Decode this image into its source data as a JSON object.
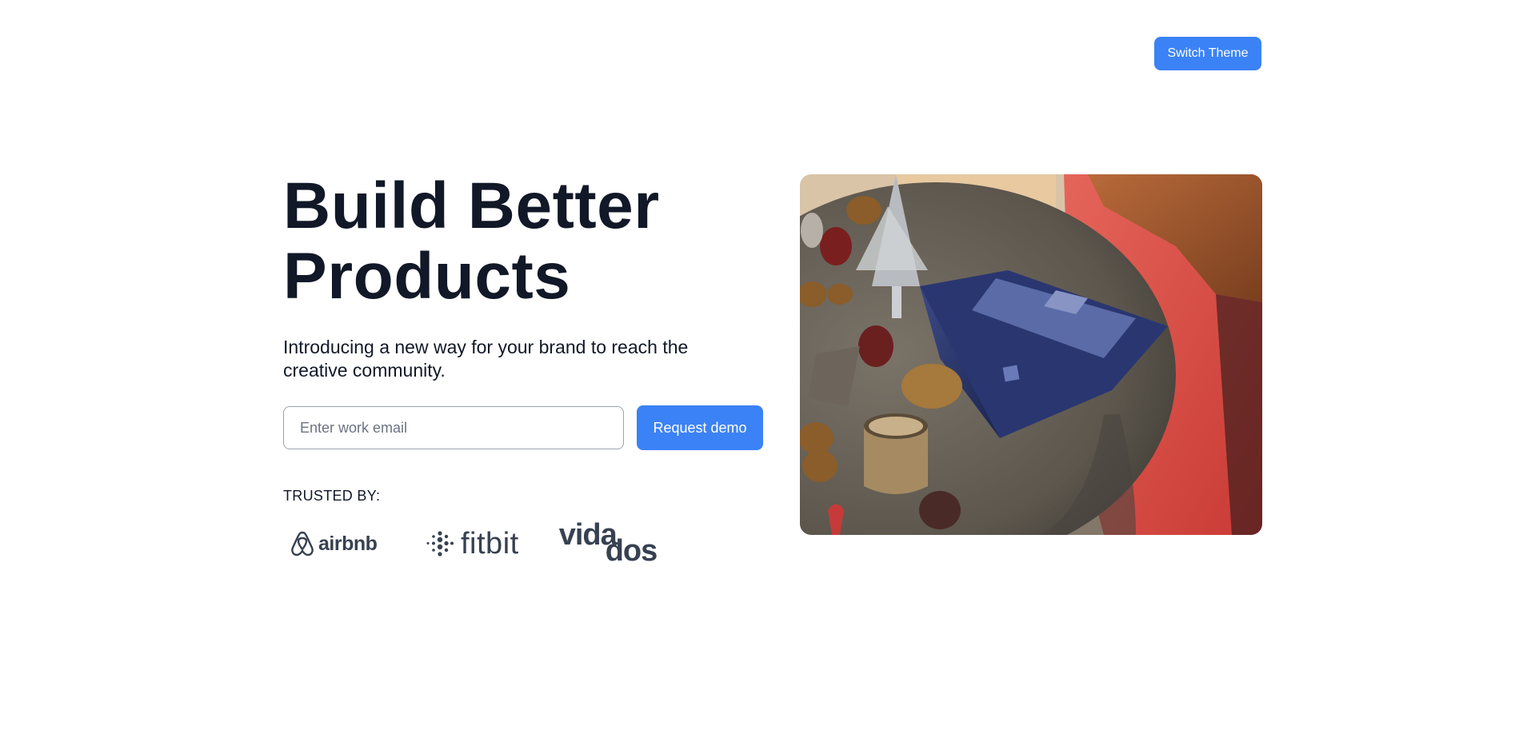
{
  "header": {
    "switch_theme_label": "Switch Theme"
  },
  "hero": {
    "title_line1": "Build Better",
    "title_line2": "Products",
    "subtitle": "Introducing a new way for your brand to reach the creative community.",
    "email_placeholder": "Enter work email",
    "email_value": "",
    "request_demo_label": "Request demo",
    "trusted_label": "TRUSTED BY:",
    "logos": [
      {
        "name": "airbnb",
        "icon": "airbnb-logo-icon"
      },
      {
        "name": "fitbit",
        "icon": "fitbit-logo-icon"
      },
      {
        "name": "vidados",
        "text_top": "vida",
        "text_bottom": "dos"
      }
    ]
  },
  "image": {
    "subject": "laptop-on-table-photo"
  },
  "colors": {
    "accent": "#3b82f6",
    "text": "#111827",
    "logo": "#374151"
  }
}
